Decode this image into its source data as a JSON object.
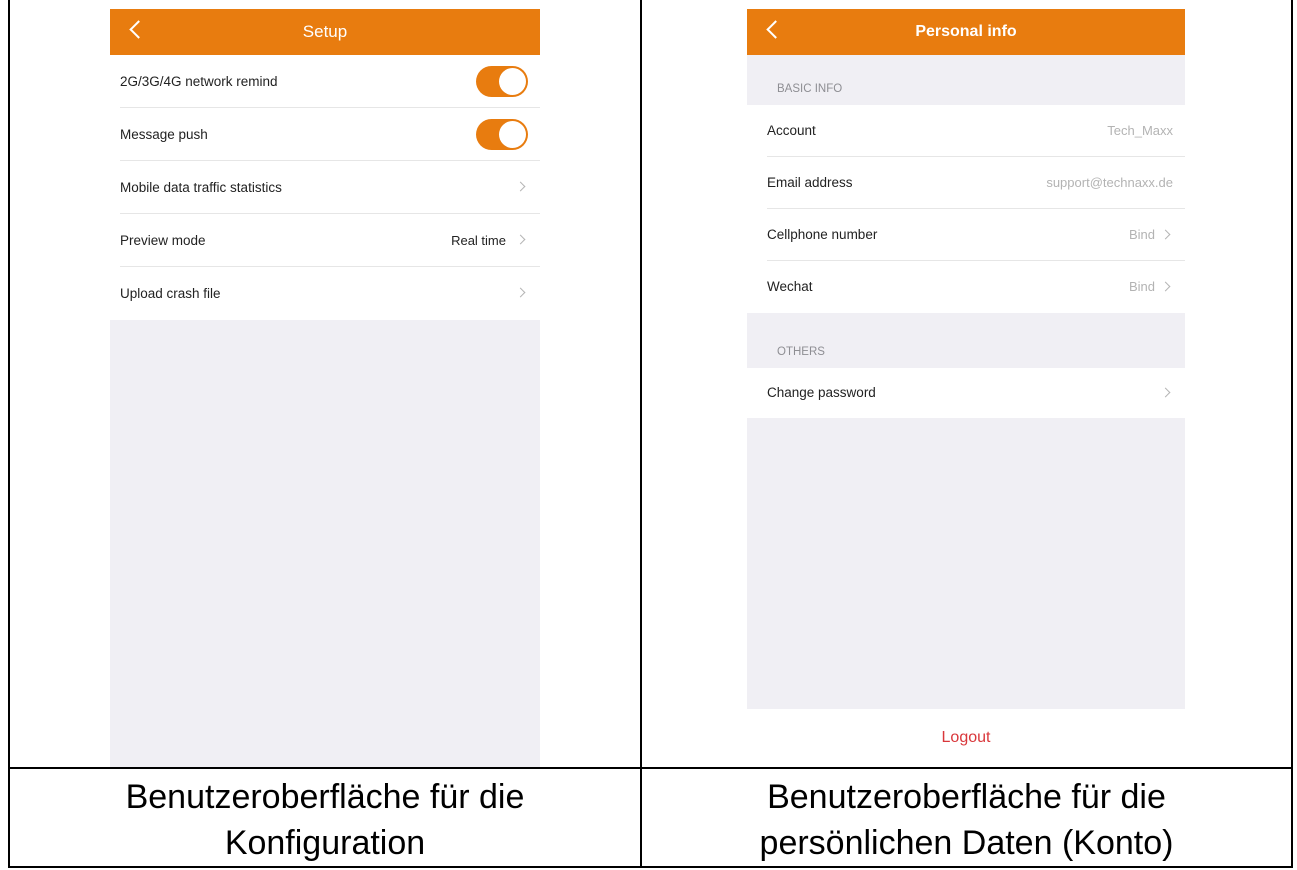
{
  "setup": {
    "title": "Setup",
    "rows": [
      {
        "label": "2G/3G/4G network remind",
        "control": "toggle",
        "state": "on"
      },
      {
        "label": "Message push",
        "control": "toggle",
        "state": "on"
      },
      {
        "label": "Mobile data traffic statistics",
        "control": "chevron"
      },
      {
        "label": "Preview mode",
        "value": "Real time",
        "control": "chevron"
      },
      {
        "label": "Upload crash file",
        "control": "chevron"
      }
    ]
  },
  "personal": {
    "title": "Personal info",
    "basic_header": "BASIC INFO",
    "basic_rows": [
      {
        "label": "Account",
        "value": "Tech_Maxx"
      },
      {
        "label": "Email address",
        "value": "support@technaxx.de"
      },
      {
        "label": "Cellphone number",
        "value": "Bind"
      },
      {
        "label": "Wechat",
        "value": "Bind"
      }
    ],
    "others_header": "OTHERS",
    "others_rows": [
      {
        "label": "Change password"
      }
    ],
    "logout": "Logout"
  },
  "captions": {
    "left": "Benutzeroberfläche für die Konfiguration",
    "right": "Benutzeroberfläche für die persönlichen Daten (Konto)"
  },
  "colors": {
    "accent": "#e87c0f",
    "background": "#f0eff4",
    "logout": "#d9373b"
  },
  "icons": [
    "back-chevron-icon",
    "chevron-right-icon",
    "toggle-switch"
  ]
}
